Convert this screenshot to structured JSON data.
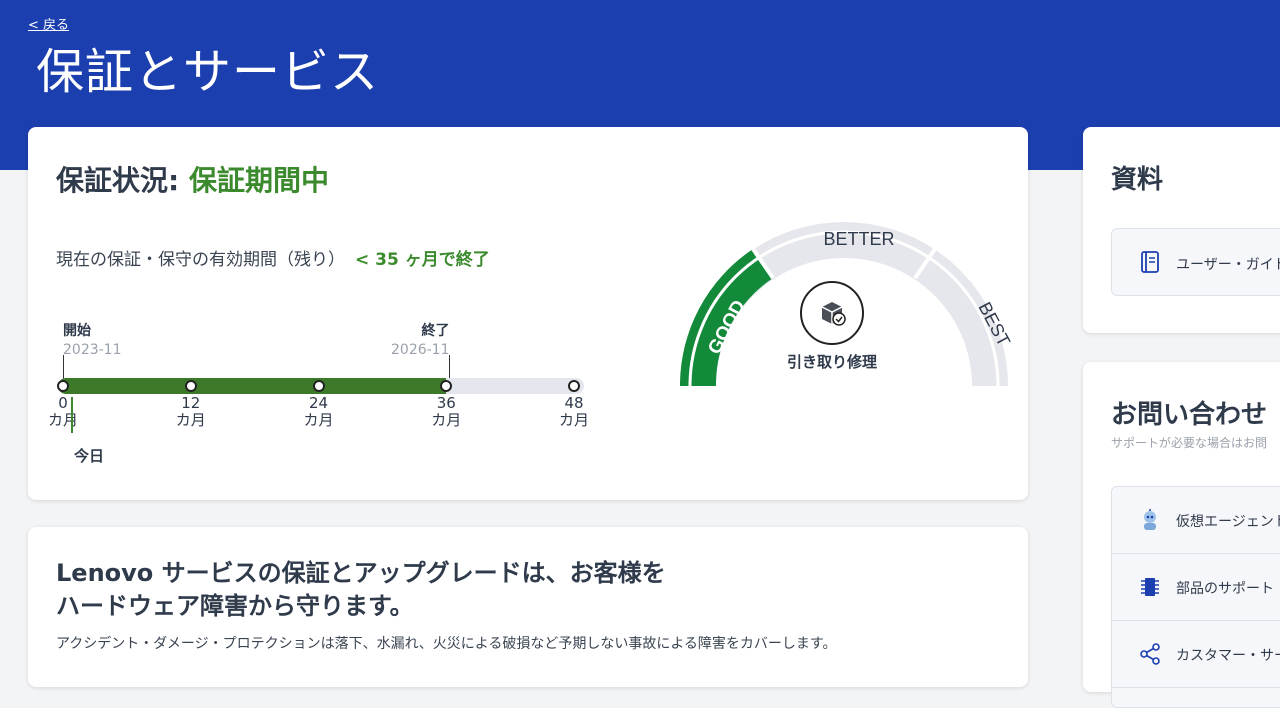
{
  "header": {
    "back_label": "< 戻る",
    "title": "保証とサービス"
  },
  "warranty": {
    "status_label": "保証状況:",
    "status_value": "保証期間中",
    "remaining_label": "現在の保証・保守の有効期間（残り）",
    "remaining_value": "< 35 ヶ月で終了",
    "start_label": "開始",
    "start_date": "2023-11",
    "end_label": "終了",
    "end_date": "2026-11",
    "elapsed_months": 1,
    "covered_months": 36,
    "scale_max_months": 48,
    "ticks": [
      {
        "value": "0",
        "unit": "カ月"
      },
      {
        "value": "12",
        "unit": "カ月"
      },
      {
        "value": "24",
        "unit": "カ月"
      },
      {
        "value": "36",
        "unit": "カ月"
      },
      {
        "value": "48",
        "unit": "カ月"
      }
    ],
    "today_label": "今日"
  },
  "service_gauge": {
    "levels": [
      "GOOD",
      "BETTER",
      "BEST"
    ],
    "active_level": "GOOD",
    "active_color": "#138a3a",
    "service_icon": "repair-box-icon",
    "service_label": "引き取り修理"
  },
  "promo": {
    "title_brand": "Lenovo",
    "title_line1": "サービスの保証とアップグレードは、お客様を",
    "title_line2": "ハードウェア障害から守ります。",
    "description": "アクシデント・ダメージ・プロテクションは落下、水漏れ、火災による破損など予期しない事故による障害をカバーします。"
  },
  "docs": {
    "title": "資料",
    "items": [
      {
        "label": "ユーザー・ガイド",
        "icon": "book-icon"
      }
    ]
  },
  "contact": {
    "title": "お問い合わせ",
    "subtitle": "サポートが必要な場合はお問",
    "items": [
      {
        "label": "仮想エージェント",
        "icon": "robot-icon"
      },
      {
        "label": "部品のサポート",
        "icon": "chip-icon"
      },
      {
        "label": "カスタマー・サービ",
        "icon": "share-icon"
      }
    ]
  },
  "colors": {
    "brand_blue": "#1c3faf",
    "status_green": "#3c8a2e",
    "bar_green": "#3c7a2a"
  }
}
